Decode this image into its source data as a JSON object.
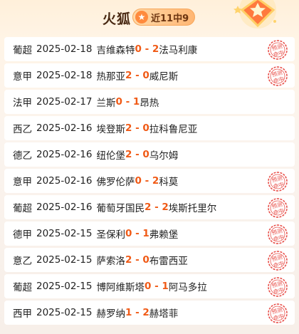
{
  "header": {
    "title": "火狐",
    "record": "近11中9"
  },
  "stamp_text": [
    "预测",
    "命中"
  ],
  "matches": [
    {
      "league": "葡超",
      "date": "2025-02-18",
      "home": "吉维森特",
      "home_score": "0",
      "sep": " - ",
      "away_score": "2",
      "away": "法马利康",
      "hit": true
    },
    {
      "league": "意甲",
      "date": "2025-02-18",
      "home": "热那亚",
      "home_score": "2",
      "sep": " - ",
      "away_score": "0",
      "away": "威尼斯",
      "hit": true
    },
    {
      "league": "法甲",
      "date": "2025-02-17",
      "home": "兰斯",
      "home_score": "0",
      "sep": " - ",
      "away_score": "1",
      "away": "昂热",
      "hit": false
    },
    {
      "league": "西乙",
      "date": "2025-02-16",
      "home": "埃登斯",
      "home_score": "2",
      "sep": " - ",
      "away_score": "0",
      "away": "拉科鲁尼亚",
      "hit": false
    },
    {
      "league": "德乙",
      "date": "2025-02-16",
      "home": "纽伦堡",
      "home_score": "2",
      "sep": " - ",
      "away_score": "0",
      "away": "乌尔姆",
      "hit": false
    },
    {
      "league": "意甲",
      "date": "2025-02-16",
      "home": "佛罗伦萨",
      "home_score": "0",
      "sep": " - ",
      "away_score": "2",
      "away": "科莫",
      "hit": true
    },
    {
      "league": "葡超",
      "date": "2025-02-16",
      "home": "葡萄牙国民",
      "home_score": "2",
      "sep": " - ",
      "away_score": "2",
      "away": "埃斯托里尔",
      "hit": true
    },
    {
      "league": "德甲",
      "date": "2025-02-15",
      "home": "圣保利",
      "home_score": "0",
      "sep": " - ",
      "away_score": "1",
      "away": "弗赖堡",
      "hit": true
    },
    {
      "league": "意乙",
      "date": "2025-02-15",
      "home": "萨索洛",
      "home_score": "2",
      "sep": " - ",
      "away_score": "0",
      "away": "布雷西亚",
      "hit": true
    },
    {
      "league": "葡超",
      "date": "2025-02-15",
      "home": "博阿维斯塔",
      "home_score": "0",
      "sep": " - ",
      "away_score": "1",
      "away": "阿马多拉",
      "hit": true
    },
    {
      "league": "西甲",
      "date": "2025-02-15",
      "home": "赫罗纳",
      "home_score": "1",
      "sep": " - ",
      "away_score": "2",
      "away": "赫塔菲",
      "hit": true
    }
  ],
  "colors": {
    "score": "#f05a16",
    "stamp": "#e8504a",
    "accent": "#ff8a3d"
  }
}
